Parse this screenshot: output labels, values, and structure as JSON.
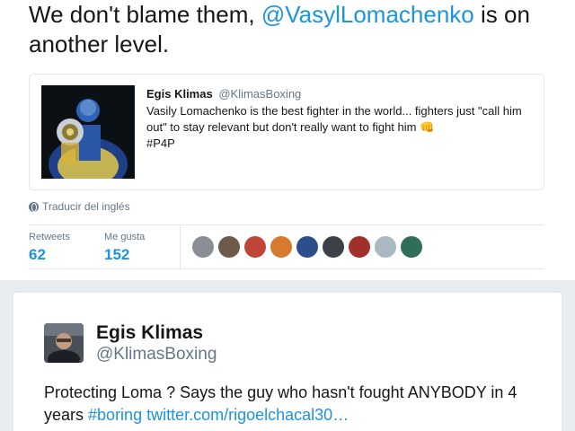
{
  "tweet": {
    "text_before": "We don't blame them, ",
    "mention": "@VasylLomachenko",
    "text_after": " is on another level."
  },
  "quoted_tweet": {
    "author_name": "Egis Klimas",
    "author_handle": "@KlimasBoxing",
    "text": "Vasily Lomachenko is the best fighter in the world... fighters just \"call him out\" to stay relevant but don't really want to fight him",
    "emoji": "👊",
    "hashtag": "#P4P"
  },
  "translate_label": "Traducir del inglés",
  "stats": {
    "retweets_label": "Retweets",
    "retweets_value": "62",
    "likes_label": "Me gusta",
    "likes_value": "152"
  },
  "liker_avatars": [
    {
      "color": "#8a8f96"
    },
    {
      "color": "#6e5a48"
    },
    {
      "color": "#c0463a"
    },
    {
      "color": "#d77a2e"
    },
    {
      "color": "#2c4f8c"
    },
    {
      "color": "#3c4148"
    },
    {
      "color": "#a1302c"
    },
    {
      "color": "#aab8c2"
    },
    {
      "color": "#2f6f5a"
    }
  ],
  "embedded_tweet": {
    "author_name": "Egis Klimas",
    "author_handle": "@KlimasBoxing",
    "text": "Protecting Loma ? Says the guy who hasn't fought ANYBODY in 4 years ",
    "hashtag": "#boring",
    "link": "twitter.com/rigoelchacal30…"
  },
  "colors": {
    "accent": "#1b95e0",
    "muted": "#657786",
    "border": "#e1e8ed",
    "background": "#e6ecf0"
  }
}
